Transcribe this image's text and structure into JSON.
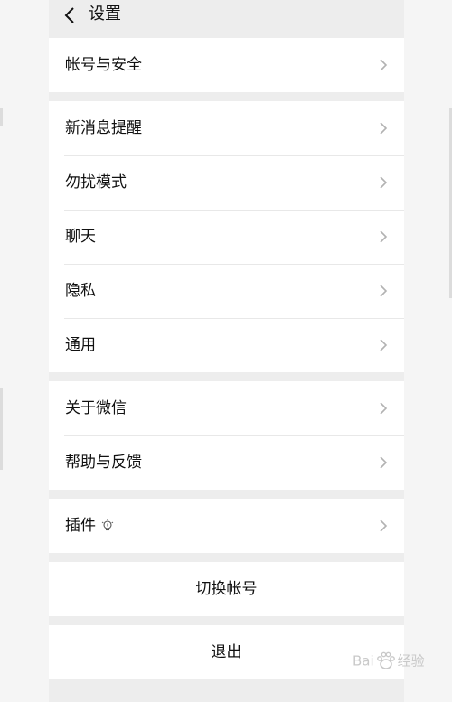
{
  "header": {
    "title": "设置"
  },
  "groups": [
    {
      "items": [
        {
          "label": "帐号与安全"
        }
      ]
    },
    {
      "items": [
        {
          "label": "新消息提醒"
        },
        {
          "label": "勿扰模式"
        },
        {
          "label": "聊天"
        },
        {
          "label": "隐私"
        },
        {
          "label": "通用"
        }
      ]
    },
    {
      "items": [
        {
          "label": "关于微信"
        },
        {
          "label": "帮助与反馈"
        }
      ]
    },
    {
      "items": [
        {
          "label": "插件"
        }
      ]
    }
  ],
  "actions": {
    "switch_account": "切换帐号",
    "logout": "退出"
  },
  "watermark": {
    "text_left": "Bai",
    "text_right": "经验"
  },
  "icons": {
    "back": "chevron-left-icon",
    "row_arrow": "chevron-right-icon",
    "plugin_badge": "lightbulb-icon"
  },
  "colors": {
    "page_background": "#ededed",
    "cell_background": "#ffffff",
    "text": "#111111",
    "chevron": "#b2b2b2"
  }
}
